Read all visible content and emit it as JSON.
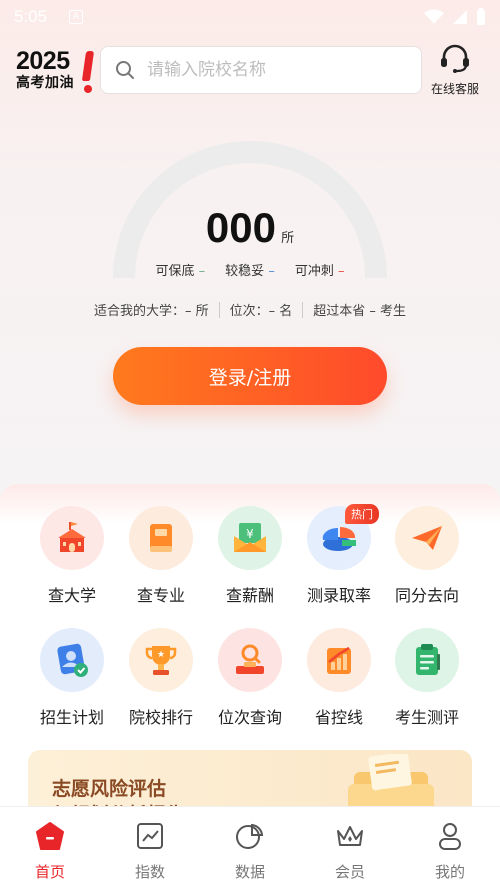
{
  "status_bar": {
    "time": "5:05"
  },
  "header": {
    "logo_year": "2025",
    "logo_slogan": "高考加油",
    "search_placeholder": "请输入院校名称",
    "service_label": "在线客服"
  },
  "score": {
    "value": "000",
    "unit": "所",
    "levels": [
      {
        "label": "可保底",
        "mark": "–"
      },
      {
        "label": "较稳妥",
        "mark": "–"
      },
      {
        "label": "可冲刺",
        "mark": "–"
      }
    ]
  },
  "stats": {
    "universities": "适合我的大学：– 所",
    "rank": "位次：– 名",
    "exceed": "超过本省 – 考生"
  },
  "login_button": "登录/注册",
  "features": [
    {
      "label": "查大学",
      "icon": "university-icon"
    },
    {
      "label": "查专业",
      "icon": "book-icon"
    },
    {
      "label": "查薪酬",
      "icon": "salary-icon"
    },
    {
      "label": "测录取率",
      "icon": "pie-chart-icon",
      "badge": "热门"
    },
    {
      "label": "同分去向",
      "icon": "paper-plane-icon"
    },
    {
      "label": "招生计划",
      "icon": "enrollment-plan-icon"
    },
    {
      "label": "院校排行",
      "icon": "trophy-icon"
    },
    {
      "label": "位次查询",
      "icon": "rank-search-icon"
    },
    {
      "label": "省控线",
      "icon": "growth-chart-icon"
    },
    {
      "label": "考生测评",
      "icon": "clipboard-icon"
    }
  ],
  "banner": {
    "line1": "志愿风险评估",
    "line2": "与规划分析报告"
  },
  "tabs": [
    {
      "label": "首页",
      "icon": "home-icon",
      "active": true
    },
    {
      "label": "指数",
      "icon": "index-chart-icon"
    },
    {
      "label": "数据",
      "icon": "data-icon"
    },
    {
      "label": "会员",
      "icon": "crown-icon"
    },
    {
      "label": "我的",
      "icon": "user-icon"
    }
  ],
  "colors": {
    "accent": "#e8262a",
    "button_start": "#ff7a1d",
    "button_end": "#ff4a2b"
  }
}
